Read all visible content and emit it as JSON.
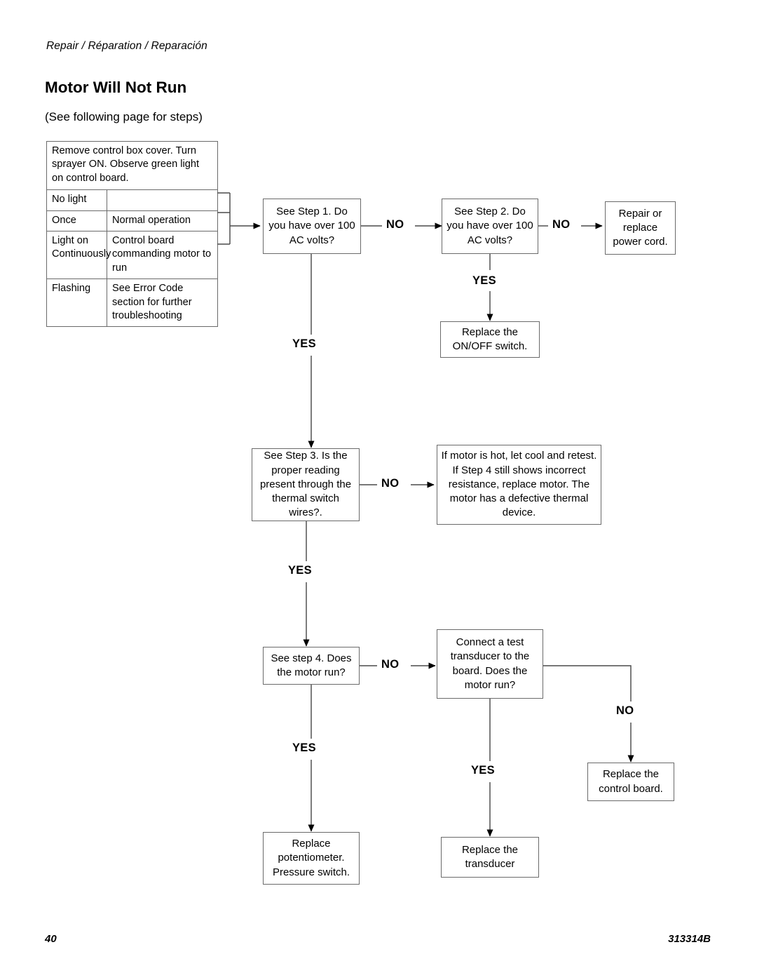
{
  "header": {
    "running_head": "Repair / Réparation / Reparación",
    "title": "Motor Will Not Run",
    "subtitle": "(See following page for steps)"
  },
  "observation_table": {
    "instruction": "Remove control box cover. Turn sprayer ON. Observe green light on control board.",
    "rows": [
      {
        "condition": "No light",
        "result": ""
      },
      {
        "condition": "Once",
        "result": "Normal operation"
      },
      {
        "condition": "Light on Continuously",
        "result": "Control board commanding motor to run"
      },
      {
        "condition": "Flashing",
        "result": "See Error Code section for further troubleshooting"
      }
    ]
  },
  "flowchart": {
    "type": "flowchart",
    "nodes": [
      {
        "id": "step1",
        "text": "See Step 1. Do you have over 100 AC volts?"
      },
      {
        "id": "step2",
        "text": "See Step 2. Do you have over 100 AC volts?"
      },
      {
        "id": "powercord",
        "text": "Repair or replace power cord."
      },
      {
        "id": "onoff",
        "text": "Replace the ON/OFF switch."
      },
      {
        "id": "step3",
        "text": "See Step 3. Is the proper reading present through the thermal switch wires?."
      },
      {
        "id": "hotmotor",
        "text": "If motor is hot, let cool and retest. If Step 4 still shows incorrect resistance, replace motor. The motor has a defective thermal device."
      },
      {
        "id": "step4",
        "text": "See step 4. Does the motor run?"
      },
      {
        "id": "transducer",
        "text": "Connect a test transducer to the board. Does the motor run?"
      },
      {
        "id": "ctrlboard",
        "text": "Replace the control board."
      },
      {
        "id": "potentiometer",
        "text": "Replace potentiometer. Pressure switch."
      },
      {
        "id": "repltrans",
        "text": "Replace the transducer"
      }
    ],
    "edges": [
      {
        "from": "step1",
        "to": "step2",
        "label": "NO"
      },
      {
        "from": "step2",
        "to": "powercord",
        "label": "NO"
      },
      {
        "from": "step2",
        "to": "onoff",
        "label": "YES"
      },
      {
        "from": "step1",
        "to": "step3",
        "label": "YES"
      },
      {
        "from": "step3",
        "to": "hotmotor",
        "label": "NO"
      },
      {
        "from": "step3",
        "to": "step4",
        "label": "YES"
      },
      {
        "from": "step4",
        "to": "transducer",
        "label": "NO"
      },
      {
        "from": "step4",
        "to": "potentiometer",
        "label": "YES"
      },
      {
        "from": "transducer",
        "to": "ctrlboard",
        "label": "NO"
      },
      {
        "from": "transducer",
        "to": "repltrans",
        "label": "YES"
      }
    ],
    "labels": {
      "no_1": "NO",
      "no_2": "NO",
      "yes_1": "YES",
      "yes_2": "YES",
      "no_3": "NO",
      "yes_3": "YES",
      "no_4": "NO",
      "no_5": "NO",
      "yes_4": "YES",
      "yes_5": "YES"
    }
  },
  "footer": {
    "page_number": "40",
    "document_number": "313314B"
  }
}
